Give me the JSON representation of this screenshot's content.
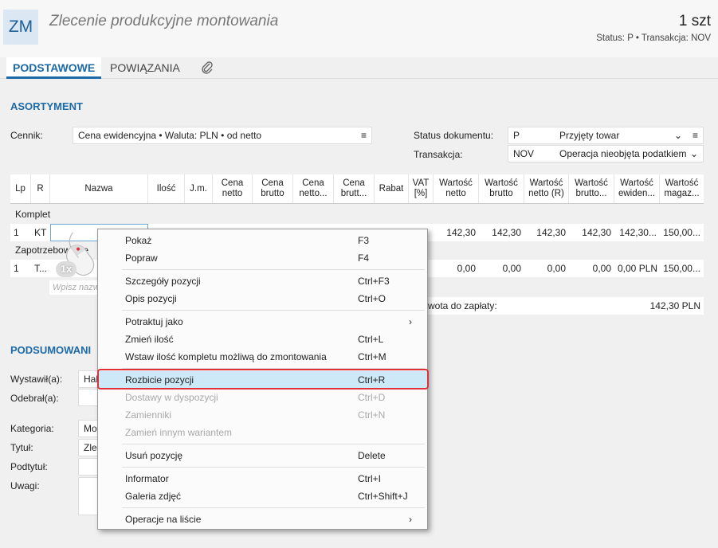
{
  "header": {
    "logo": "ZM",
    "title": "Zlecenie produkcyjne montowania",
    "qty": "1 szt",
    "status_line": "Status: P • Transakcja: NOV"
  },
  "tabs": [
    {
      "label": "PODSTAWOWE"
    },
    {
      "label": "POWIĄZANIA"
    },
    {
      "label": "📎",
      "icon": "paperclip-icon"
    }
  ],
  "assortment": {
    "title": "ASORTYMENT",
    "price_list_label": "Cennik:",
    "price_list_value": "Cena ewidencyjna • Waluta: PLN • od netto",
    "doc_status_label": "Status dokumentu:",
    "doc_status_code": "P",
    "doc_status_value": "Przyjęty towar",
    "transaction_label": "Transakcja:",
    "transaction_code": "NOV",
    "transaction_value": "Operacja nieobjęta podatkiem"
  },
  "table": {
    "columns": [
      "Lp",
      "R",
      "Nazwa",
      "Ilość",
      "J.m.",
      "Cena netto",
      "Cena brutto",
      "Cena netto...",
      "Cena brutt...",
      "Rabat",
      "VAT [%]",
      "Wartość netto",
      "Wartość brutto",
      "Wartość netto (R)",
      "Wartość brutto...",
      "Wartość ewiden...",
      "Wartość magaz..."
    ],
    "group1": "Komplet",
    "row1": {
      "lp": "1",
      "r": "KT",
      "v1": "142,30",
      "v2": "142,30",
      "v3": "142,30",
      "v4": "142,30",
      "v5": "142,30...",
      "v6": "150,00..."
    },
    "group2": "Zapotrzebowanie",
    "row2": {
      "lp": "1",
      "r": "T...",
      "v1": "0,00",
      "v2": "0,00",
      "v3": "0,00",
      "v4": "0,00",
      "v5": "0,00 PLN",
      "v6": "150,00..."
    },
    "placeholder": "Wpisz nazw",
    "total_label": "wota do zapłaty:",
    "total_value": "142,30 PLN"
  },
  "summary": {
    "title": "PODSUMOWANI",
    "issued_label": "Wystawił(a):",
    "issued_value": "Hal",
    "received_label": "Odebrał(a):",
    "category_label": "Kategoria:",
    "category_value": "Mor",
    "title_label": "Tytuł:",
    "title_value": "Zlec",
    "subtitle_label": "Podtytuł:",
    "notes_label": "Uwagi:"
  },
  "cursor_badge": "1x",
  "menu": {
    "items": [
      {
        "label": "Pokaż",
        "shortcut": "F3"
      },
      {
        "label": "Popraw",
        "shortcut": "F4"
      },
      {
        "label": "Szczegóły pozycji",
        "shortcut": "Ctrl+F3"
      },
      {
        "label": "Opis pozycji",
        "shortcut": "Ctrl+O"
      },
      {
        "label": "Potraktuj jako",
        "shortcut": "›"
      },
      {
        "label": "Zmień ilość",
        "shortcut": "Ctrl+L"
      },
      {
        "label": "Wstaw ilość kompletu możliwą do zmontowania",
        "shortcut": "Ctrl+M"
      },
      {
        "label": "Rozbicie pozycji",
        "shortcut": "Ctrl+R"
      },
      {
        "label": "Dostawy w dyspozycji",
        "shortcut": "Ctrl+D"
      },
      {
        "label": "Zamienniki",
        "shortcut": "Ctrl+N"
      },
      {
        "label": "Zamień innym wariantem",
        "shortcut": ""
      },
      {
        "label": "Usuń pozycję",
        "shortcut": "Delete"
      },
      {
        "label": "Informator",
        "shortcut": "Ctrl+I"
      },
      {
        "label": "Galeria zdjęć",
        "shortcut": "Ctrl+Shift+J"
      },
      {
        "label": "Operacje na liście",
        "shortcut": "›"
      }
    ]
  },
  "colors": {
    "accent": "#1c6aa8",
    "highlight_border": "#e2303b",
    "selected_item": "#cde8f7"
  }
}
